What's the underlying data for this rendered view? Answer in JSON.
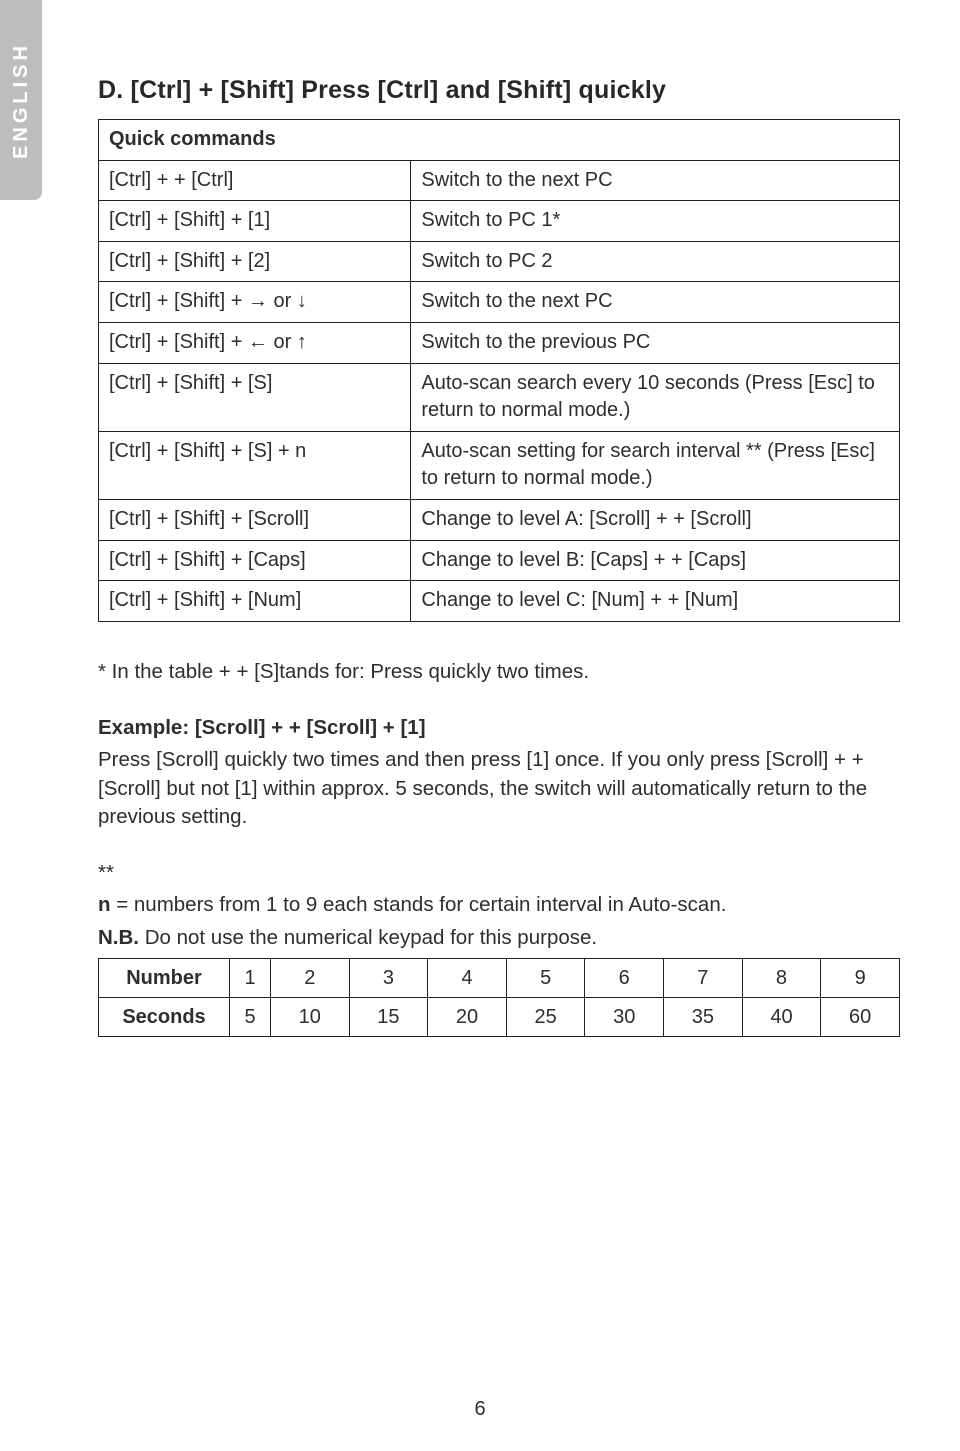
{
  "lang_tab": "ENGLISH",
  "section_title": "D. [Ctrl] + [Shift] Press [Ctrl] and [Shift] quickly",
  "cmd_table": {
    "header": "Quick commands",
    "rows": [
      {
        "k": "[Ctrl] + + [Ctrl]",
        "v": "Switch to the next PC"
      },
      {
        "k": "[Ctrl] + [Shift] + [1]",
        "v": "Switch to PC 1*"
      },
      {
        "k": "[Ctrl] + [Shift] + [2]",
        "v": "Switch to PC 2"
      },
      {
        "k": "[Ctrl] + [Shift] + → or ↓",
        "v": "Switch to the next PC"
      },
      {
        "k": "[Ctrl] + [Shift] + ← or ↑",
        "v": "Switch to the previous PC"
      },
      {
        "k": "[Ctrl] + [Shift] + [S]",
        "v": "Auto-scan search every 10 seconds (Press [Esc] to return to normal mode.)"
      },
      {
        "k": "[Ctrl] + [Shift] + [S] + n",
        "v": "Auto-scan setting for search interval ** (Press [Esc] to return to normal mode.)"
      },
      {
        "k": "[Ctrl] + [Shift] + [Scroll]",
        "v": "Change to level A: [Scroll] + + [Scroll]"
      },
      {
        "k": "[Ctrl] + [Shift] + [Caps]",
        "v": "Change to level B: [Caps] + + [Caps]"
      },
      {
        "k": "[Ctrl] + [Shift] + [Num]",
        "v": "Change to level C: [Num] + + [Num]"
      }
    ]
  },
  "note_star": "* In the table + + [S]tands for: Press quickly two times.",
  "example_title": "Example: [Scroll] + + [Scroll] + [1]",
  "example_body": "Press [Scroll] quickly two times and then press [1] once. If you only press [Scroll] + + [Scroll] but not [1] within approx. 5 seconds, the switch will automatically return to the previous setting.",
  "star2": "**",
  "n_line_prefix": "n",
  "n_line_rest": " = numbers from 1 to 9 each stands for certain interval in Auto-scan.",
  "nb_label": "N.B.",
  "nb_rest": " Do not use the numerical keypad for this purpose.",
  "num_table": {
    "row1_label": "Number",
    "row1": [
      "1",
      "2",
      "3",
      "4",
      "5",
      "6",
      "7",
      "8",
      "9"
    ],
    "row2_label": "Seconds",
    "row2": [
      "5",
      "10",
      "15",
      "20",
      "25",
      "30",
      "35",
      "40",
      "60"
    ]
  },
  "page_number": "6"
}
